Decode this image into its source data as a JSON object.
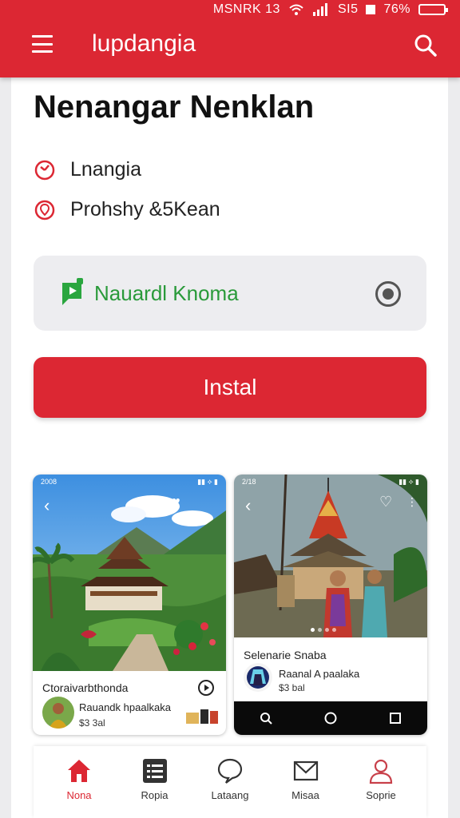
{
  "status": {
    "left_text": "MSNRK 13",
    "sim_text": "SI5",
    "battery": "76%",
    "battery_level": 0.76
  },
  "appbar": {
    "title": "lupdangia",
    "menu_icon": "hamburger-menu-icon",
    "search_icon": "search-icon"
  },
  "page": {
    "title": "Nenangar Nenklan",
    "info": [
      {
        "icon": "clock-icon",
        "text": "Lnangia"
      },
      {
        "icon": "location-icon",
        "text": "Prohshy &5Kean"
      }
    ]
  },
  "app_card": {
    "name": "Nauardl Knoma",
    "logo_icon": "app-logo-icon",
    "radio_icon": "radio-selected-icon"
  },
  "install_button": "Instal",
  "screenshots": [
    {
      "time": "2008",
      "caption": "Ctoraivarbthonda",
      "sub_name": "Rauandk hpaalkaka",
      "sub_price": "$3 3al"
    },
    {
      "time": "2/18",
      "caption": "Selenarie Snaba",
      "sub_name": "Raanal A paalaka",
      "sub_price": "$3 bal"
    }
  ],
  "bottom_nav": [
    {
      "label": "Nona",
      "icon": "home-icon",
      "active": true
    },
    {
      "label": "Ropia",
      "icon": "list-icon",
      "active": false
    },
    {
      "label": "Lataang",
      "icon": "chat-bubble-icon",
      "active": false
    },
    {
      "label": "Misaa",
      "icon": "mail-icon",
      "active": false
    },
    {
      "label": "Soprie",
      "icon": "user-icon",
      "active": false
    }
  ],
  "colors": {
    "brand": "#dc2733",
    "app_name": "#2a9a3a"
  }
}
